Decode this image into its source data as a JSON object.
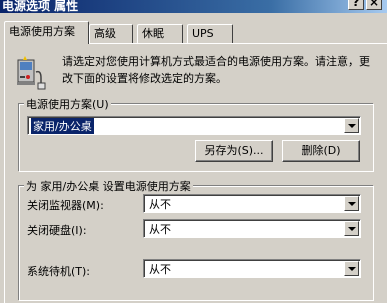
{
  "window": {
    "title": "电源选项 属性",
    "help_button": "?",
    "close_button": "×"
  },
  "tabs": [
    {
      "label": "电源使用方案",
      "active": true
    },
    {
      "label": "高级",
      "active": false
    },
    {
      "label": "休眠",
      "active": false
    },
    {
      "label": "UPS",
      "active": false
    }
  ],
  "description": "请选定对您使用计算机方式最适合的电源使用方案。请注意，更改下面的设置将修改选定的方案。",
  "scheme_group": {
    "label": "电源使用方案(U)",
    "selected": "家用/办公桌",
    "save_as_label": "另存为(S)...",
    "delete_label": "删除(D)"
  },
  "settings_group": {
    "label": "为 家用/办公桌 设置电源使用方案",
    "monitor_label": "关闭监视器(M):",
    "monitor_value": "从不",
    "harddisk_label": "关闭硬盘(I):",
    "harddisk_value": "从不",
    "standby_label": "系统待机(T):",
    "standby_value": "从不"
  },
  "icon": "power-options-icon"
}
